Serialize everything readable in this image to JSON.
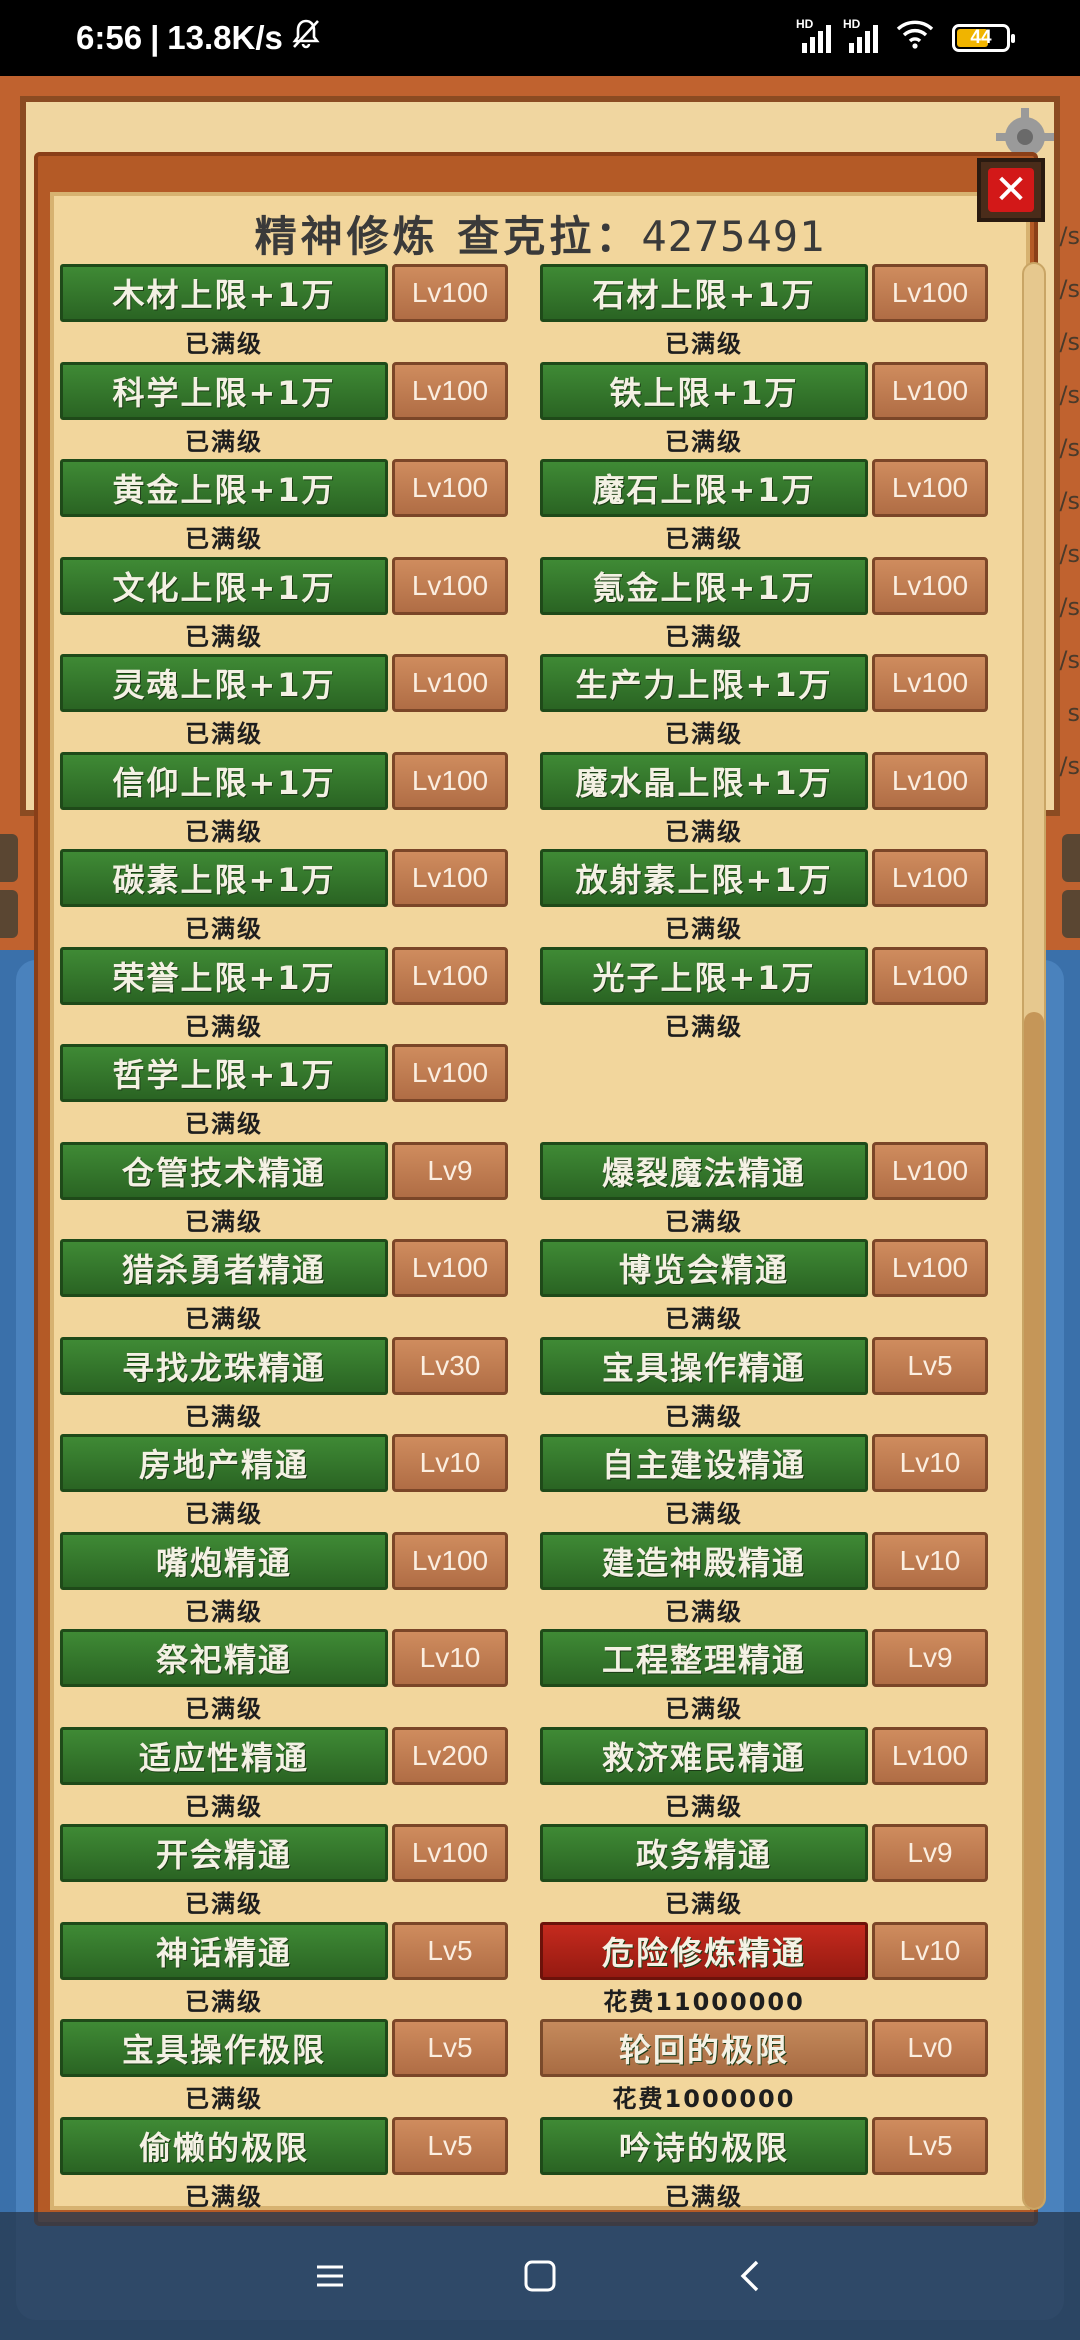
{
  "status_bar": {
    "time": "6:56",
    "network_speed": "13.8K/s",
    "signal_label": "HD",
    "battery": "44"
  },
  "background": {
    "side_text": [
      "/s",
      "/s",
      "/s",
      "/s",
      "/s",
      "/s",
      "/s",
      "/s",
      "/s",
      "s",
      "/s"
    ]
  },
  "header": {
    "title": "精神修炼",
    "currency_label": "查克拉：",
    "currency_value": "4275491"
  },
  "skills": [
    {
      "name": "木材上限+1万",
      "level": "Lv100",
      "status": "已满级",
      "style": "green"
    },
    {
      "name": "石材上限+1万",
      "level": "Lv100",
      "status": "已满级",
      "style": "green"
    },
    {
      "name": "科学上限+1万",
      "level": "Lv100",
      "status": "已满级",
      "style": "green"
    },
    {
      "name": "铁上限+1万",
      "level": "Lv100",
      "status": "已满级",
      "style": "green"
    },
    {
      "name": "黄金上限+1万",
      "level": "Lv100",
      "status": "已满级",
      "style": "green"
    },
    {
      "name": "魔石上限+1万",
      "level": "Lv100",
      "status": "已满级",
      "style": "green"
    },
    {
      "name": "文化上限+1万",
      "level": "Lv100",
      "status": "已满级",
      "style": "green"
    },
    {
      "name": "氪金上限+1万",
      "level": "Lv100",
      "status": "已满级",
      "style": "green"
    },
    {
      "name": "灵魂上限+1万",
      "level": "Lv100",
      "status": "已满级",
      "style": "green"
    },
    {
      "name": "生产力上限+1万",
      "level": "Lv100",
      "status": "已满级",
      "style": "green"
    },
    {
      "name": "信仰上限+1万",
      "level": "Lv100",
      "status": "已满级",
      "style": "green"
    },
    {
      "name": "魔水晶上限+1万",
      "level": "Lv100",
      "status": "已满级",
      "style": "green"
    },
    {
      "name": "碳素上限+1万",
      "level": "Lv100",
      "status": "已满级",
      "style": "green"
    },
    {
      "name": "放射素上限+1万",
      "level": "Lv100",
      "status": "已满级",
      "style": "green"
    },
    {
      "name": "荣誉上限+1万",
      "level": "Lv100",
      "status": "已满级",
      "style": "green"
    },
    {
      "name": "光子上限+1万",
      "level": "Lv100",
      "status": "已满级",
      "style": "green"
    },
    {
      "name": "哲学上限+1万",
      "level": "Lv100",
      "status": "已满级",
      "style": "green"
    },
    null,
    {
      "name": "仓管技术精通",
      "level": "Lv9",
      "status": "已满级",
      "style": "green"
    },
    {
      "name": "爆裂魔法精通",
      "level": "Lv100",
      "status": "已满级",
      "style": "green"
    },
    {
      "name": "猎杀勇者精通",
      "level": "Lv100",
      "status": "已满级",
      "style": "green"
    },
    {
      "name": "博览会精通",
      "level": "Lv100",
      "status": "已满级",
      "style": "green"
    },
    {
      "name": "寻找龙珠精通",
      "level": "Lv30",
      "status": "已满级",
      "style": "green"
    },
    {
      "name": "宝具操作精通",
      "level": "Lv5",
      "status": "已满级",
      "style": "green"
    },
    {
      "name": "房地产精通",
      "level": "Lv10",
      "status": "已满级",
      "style": "green"
    },
    {
      "name": "自主建设精通",
      "level": "Lv10",
      "status": "已满级",
      "style": "green"
    },
    {
      "name": "嘴炮精通",
      "level": "Lv100",
      "status": "已满级",
      "style": "green"
    },
    {
      "name": "建造神殿精通",
      "level": "Lv10",
      "status": "已满级",
      "style": "green"
    },
    {
      "name": "祭祀精通",
      "level": "Lv10",
      "status": "已满级",
      "style": "green"
    },
    {
      "name": "工程整理精通",
      "level": "Lv9",
      "status": "已满级",
      "style": "green"
    },
    {
      "name": "适应性精通",
      "level": "Lv200",
      "status": "已满级",
      "style": "green"
    },
    {
      "name": "救济难民精通",
      "level": "Lv100",
      "status": "已满级",
      "style": "green"
    },
    {
      "name": "开会精通",
      "level": "Lv100",
      "status": "已满级",
      "style": "green"
    },
    {
      "name": "政务精通",
      "level": "Lv9",
      "status": "已满级",
      "style": "green"
    },
    {
      "name": "神话精通",
      "level": "Lv5",
      "status": "已满级",
      "style": "green"
    },
    {
      "name": "危险修炼精通",
      "level": "Lv10",
      "status": "花费11000000",
      "style": "red"
    },
    {
      "name": "宝具操作极限",
      "level": "Lv5",
      "status": "已满级",
      "style": "green"
    },
    {
      "name": "轮回的极限",
      "level": "Lv0",
      "status": "花费1000000",
      "style": "brown"
    },
    {
      "name": "偷懒的极限",
      "level": "Lv5",
      "status": "已满级",
      "style": "green"
    },
    {
      "name": "吟诗的极限",
      "level": "Lv5",
      "status": "已满级",
      "style": "green"
    }
  ]
}
